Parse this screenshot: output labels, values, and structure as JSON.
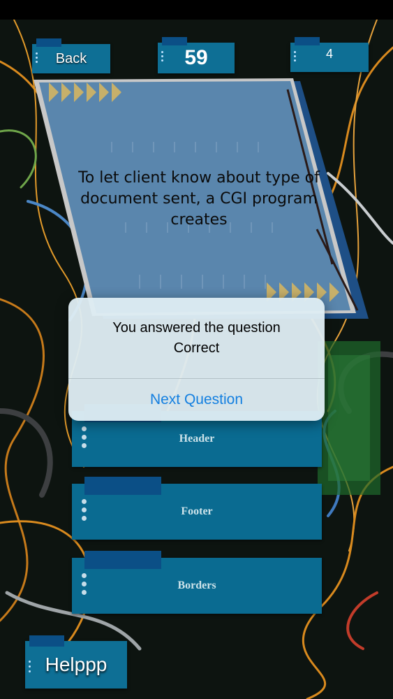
{
  "header": {
    "back_label": "Back",
    "score": "59",
    "count": "4"
  },
  "question": {
    "text": "To let client know about type of document sent, a CGI program creates"
  },
  "dialog": {
    "message": "You answered the question Correct",
    "button_label": "Next Question"
  },
  "answers": [
    {
      "label": "Header"
    },
    {
      "label": "Footer"
    },
    {
      "label": "Borders"
    }
  ],
  "help": {
    "label": "Helppp"
  },
  "colors": {
    "button_blue": "#0e6f95",
    "tag_blue": "#0b4f86",
    "card_blue": "#5a86ad",
    "arrow_gold": "#c7b06a",
    "link_blue": "#137fe0"
  }
}
